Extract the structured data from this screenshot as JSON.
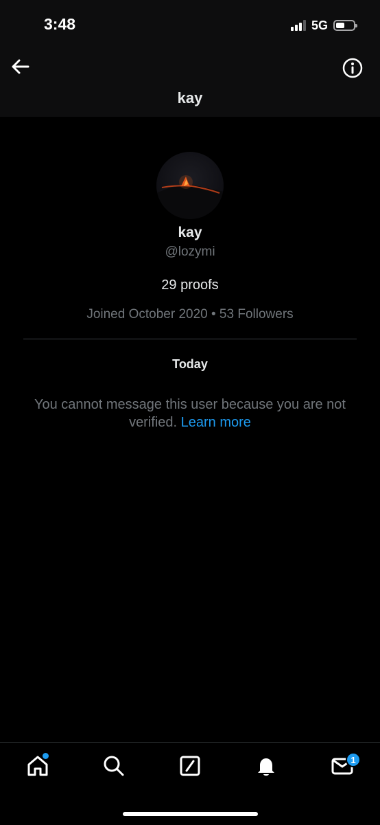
{
  "status_bar": {
    "time": "3:48",
    "network": "5G",
    "icons": [
      "signal-icon",
      "battery-icon"
    ]
  },
  "header": {
    "title": "kay",
    "back_icon": "arrow-left-icon",
    "info_icon": "info-circle-icon"
  },
  "profile": {
    "name": "kay",
    "handle": "@lozymi",
    "bio": "29 proofs",
    "meta": "Joined October 2020 • 53 Followers"
  },
  "conversation": {
    "day_label": "Today",
    "notice_text": "You cannot message this user because you are not verified.",
    "notice_link": "Learn more"
  },
  "bottom_nav": {
    "items": [
      "home-icon",
      "search-icon",
      "grok-icon",
      "notifications-icon",
      "messages-icon"
    ],
    "messages_badge": "1"
  },
  "colors": {
    "background": "#000000",
    "header_background": "#0d0d0e",
    "text_primary": "#e7e9ea",
    "text_secondary": "#71767b",
    "accent": "#1d9bf0"
  }
}
